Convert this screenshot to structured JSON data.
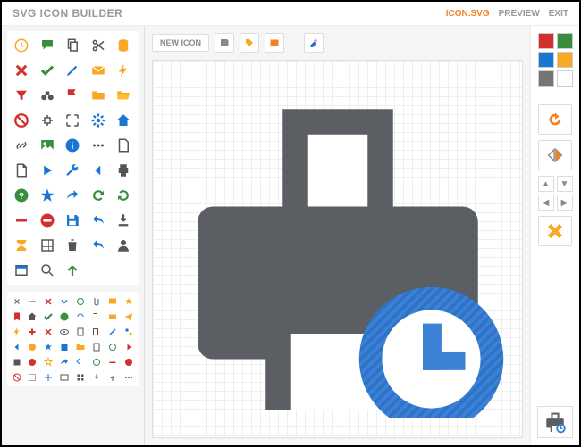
{
  "app_title": "SVG ICON BUILDER",
  "header_links": {
    "filename": "ICON.SVG",
    "preview": "PREVIEW",
    "exit": "EXIT"
  },
  "toolbar": {
    "new_icon": "NEW ICON"
  },
  "colors": [
    "#d32f2f",
    "#388e3c",
    "#1976d2",
    "#f9a825",
    "#757575",
    "#ffffff"
  ],
  "chart_data": {
    "type": "table",
    "description": "SVG icon editor with icon palette sidebar, grid canvas showing a printer icon with a scheduled-clock badge overlay, and right-side color/transform controls."
  }
}
